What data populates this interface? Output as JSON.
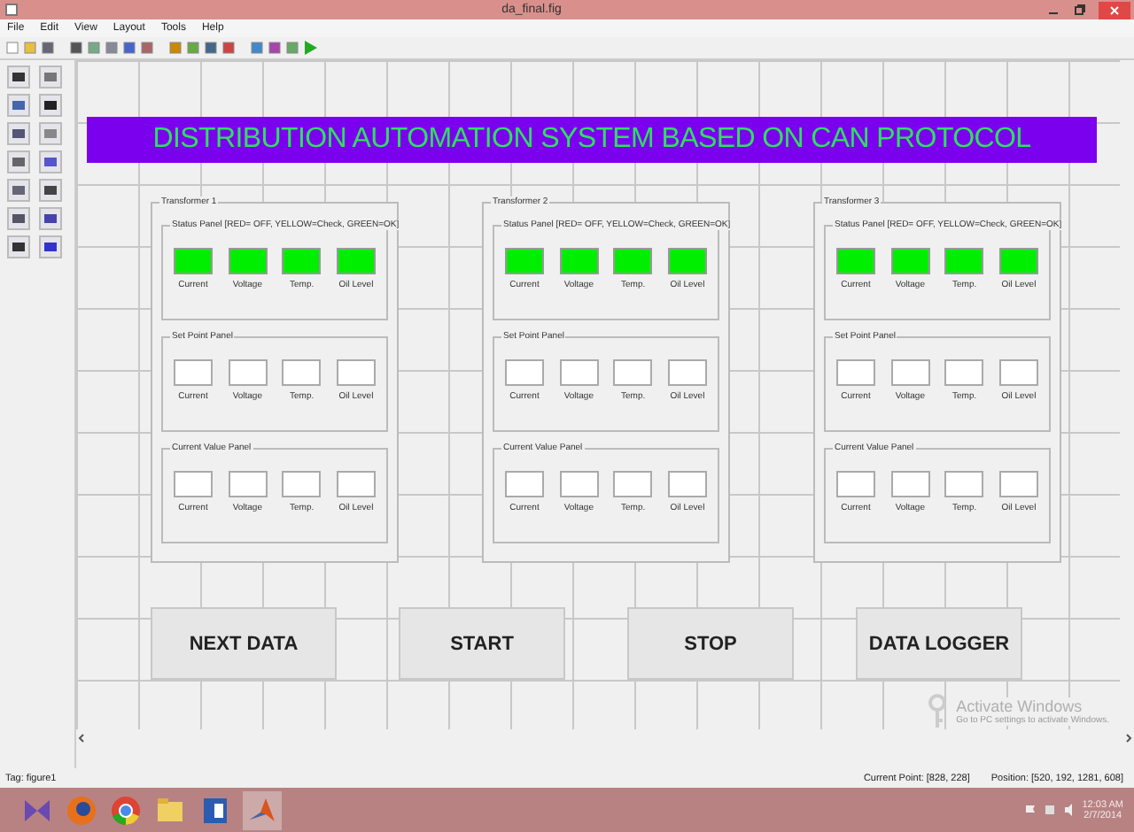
{
  "window": {
    "title": "da_final.fig"
  },
  "menu": [
    "File",
    "Edit",
    "View",
    "Layout",
    "Tools",
    "Help"
  ],
  "banner": "DISTRIBUTION AUTOMATION SYSTEM BASED ON CAN PROTOCOL",
  "transformers": [
    {
      "title": "Transformer 1",
      "panels": [
        {
          "kind": "status",
          "title": "Status Panel [RED= OFF, YELLOW=Check, GREEN=OK]",
          "items": [
            {
              "label": "Current",
              "color": "#00ee00"
            },
            {
              "label": "Voltage",
              "color": "#00ee00"
            },
            {
              "label": "Temp.",
              "color": "#00ee00"
            },
            {
              "label": "Oil Level",
              "color": "#00ee00"
            }
          ]
        },
        {
          "kind": "input",
          "title": "Set Point Panel",
          "items": [
            {
              "label": "Current"
            },
            {
              "label": "Voltage"
            },
            {
              "label": "Temp."
            },
            {
              "label": "Oil Level"
            }
          ]
        },
        {
          "kind": "input",
          "title": "Current Value Panel",
          "items": [
            {
              "label": "Current"
            },
            {
              "label": "Voltage"
            },
            {
              "label": "Temp."
            },
            {
              "label": "Oil Level"
            }
          ]
        }
      ]
    },
    {
      "title": "Transformer 2",
      "panels": [
        {
          "kind": "status",
          "title": "Status Panel [RED= OFF, YELLOW=Check, GREEN=OK]",
          "items": [
            {
              "label": "Current",
              "color": "#00ee00"
            },
            {
              "label": "Voltage",
              "color": "#00ee00"
            },
            {
              "label": "Temp.",
              "color": "#00ee00"
            },
            {
              "label": "Oil Level",
              "color": "#00ee00"
            }
          ]
        },
        {
          "kind": "input",
          "title": "Set Point Panel",
          "items": [
            {
              "label": "Current"
            },
            {
              "label": "Voltage"
            },
            {
              "label": "Temp."
            },
            {
              "label": "Oil Level"
            }
          ]
        },
        {
          "kind": "input",
          "title": "Current Value Panel",
          "items": [
            {
              "label": "Current"
            },
            {
              "label": "Voltage"
            },
            {
              "label": "Temp."
            },
            {
              "label": "Oil Level"
            }
          ]
        }
      ]
    },
    {
      "title": "Transformer 3",
      "panels": [
        {
          "kind": "status",
          "title": "Status Panel [RED= OFF, YELLOW=Check, GREEN=OK]",
          "items": [
            {
              "label": "Current",
              "color": "#00ee00"
            },
            {
              "label": "Voltage",
              "color": "#00ee00"
            },
            {
              "label": "Temp.",
              "color": "#00ee00"
            },
            {
              "label": "Oil Level",
              "color": "#00ee00"
            }
          ]
        },
        {
          "kind": "input",
          "title": "Set Point Panel",
          "items": [
            {
              "label": "Current"
            },
            {
              "label": "Voltage"
            },
            {
              "label": "Temp."
            },
            {
              "label": "Oil Level"
            }
          ]
        },
        {
          "kind": "input",
          "title": "Current Value Panel",
          "items": [
            {
              "label": "Current"
            },
            {
              "label": "Voltage"
            },
            {
              "label": "Temp."
            },
            {
              "label": "Oil Level"
            }
          ]
        }
      ]
    }
  ],
  "buttons": [
    "NEXT DATA",
    "START",
    "STOP",
    "DATA LOGGER"
  ],
  "activation_notice": {
    "title": "Activate Windows",
    "subtitle": "Go to PC settings to activate Windows."
  },
  "status_bar": {
    "tag": "Tag: figure1",
    "current_point": "Current Point:  [828, 228]",
    "position": "Position: [520, 192, 1281, 608]"
  },
  "taskbar": {
    "time": "12:03 AM",
    "date": "2/7/2014"
  }
}
